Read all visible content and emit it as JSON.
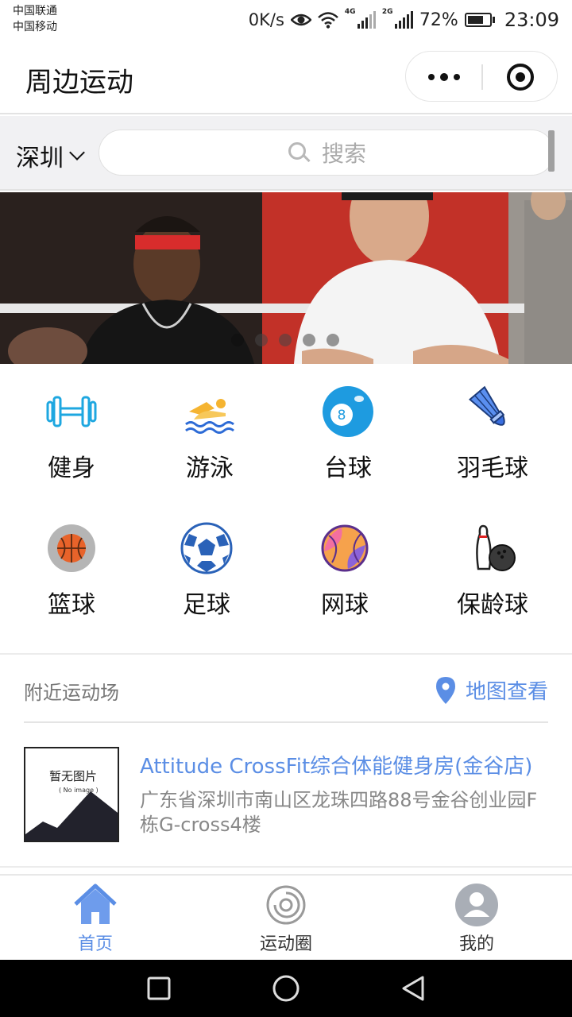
{
  "status_bar": {
    "carrier_1": "中国联通",
    "carrier_2": "中国移动",
    "net_speed": "0K/s",
    "sim1_tag": "4G",
    "sim2_tag": "2G",
    "battery": "72%",
    "battery_level": 0.72,
    "time": "23:09"
  },
  "nav": {
    "title": "周边运动"
  },
  "search": {
    "city": "深圳",
    "placeholder": "搜索"
  },
  "banner": {
    "slide_count": 5,
    "active_index": 0
  },
  "categories": [
    {
      "label": "健身",
      "icon": "dumbbell-icon"
    },
    {
      "label": "游泳",
      "icon": "swimming-icon"
    },
    {
      "label": "台球",
      "icon": "billiards-icon"
    },
    {
      "label": "羽毛球",
      "icon": "badminton-icon"
    },
    {
      "label": "篮球",
      "icon": "basketball-icon"
    },
    {
      "label": "足球",
      "icon": "soccer-ball-icon"
    },
    {
      "label": "网球",
      "icon": "baseball-icon"
    },
    {
      "label": "保龄球",
      "icon": "bowling-icon"
    }
  ],
  "nearby": {
    "title": "附近运动场",
    "map_link": "地图查看",
    "venues": [
      {
        "name": "Attitude CrossFit综合体能健身房(金谷店)",
        "address": "广东省深圳市南山区龙珠四路88号金谷创业园F栋G-cross4楼",
        "thumb_text": "暂无图片",
        "thumb_sub": "( No image )"
      }
    ]
  },
  "tabs": [
    {
      "label": "首页",
      "icon": "home-icon",
      "active": true
    },
    {
      "label": "运动圈",
      "icon": "circle-feed-icon",
      "active": false
    },
    {
      "label": "我的",
      "icon": "profile-icon",
      "active": false
    }
  ],
  "colors": {
    "accent": "#5b8ee5",
    "search_row_bg": "#f1f1f3"
  }
}
